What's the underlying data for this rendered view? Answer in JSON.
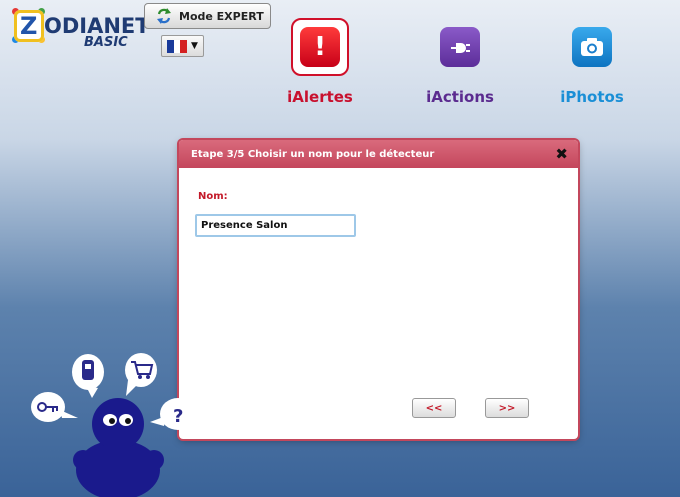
{
  "brand": {
    "name": "ODIANET",
    "letter": "Z",
    "edition": "BASIC"
  },
  "toolbar": {
    "mode_label": "Mode EXPERT"
  },
  "language": {
    "selected": "fr",
    "flag": [
      "#1a3a9a",
      "#ffffff",
      "#d42020"
    ]
  },
  "apps": [
    {
      "label": "iAlertes",
      "icon": "exclamation-icon",
      "color": "#c8102e"
    },
    {
      "label": "iActions",
      "icon": "plug-icon",
      "color": "#5b2b8f"
    },
    {
      "label": "iPhotos",
      "icon": "camera-icon",
      "color": "#1a8fd6"
    }
  ],
  "dialog": {
    "title": "Etape 3/5 Choisir un nom pour le détecteur",
    "close": "✖",
    "field_label": "Nom:",
    "field_value": "Presence Salon",
    "prev_label": "<<",
    "next_label": ">>"
  },
  "mascot": {
    "bubble_question": "?"
  }
}
